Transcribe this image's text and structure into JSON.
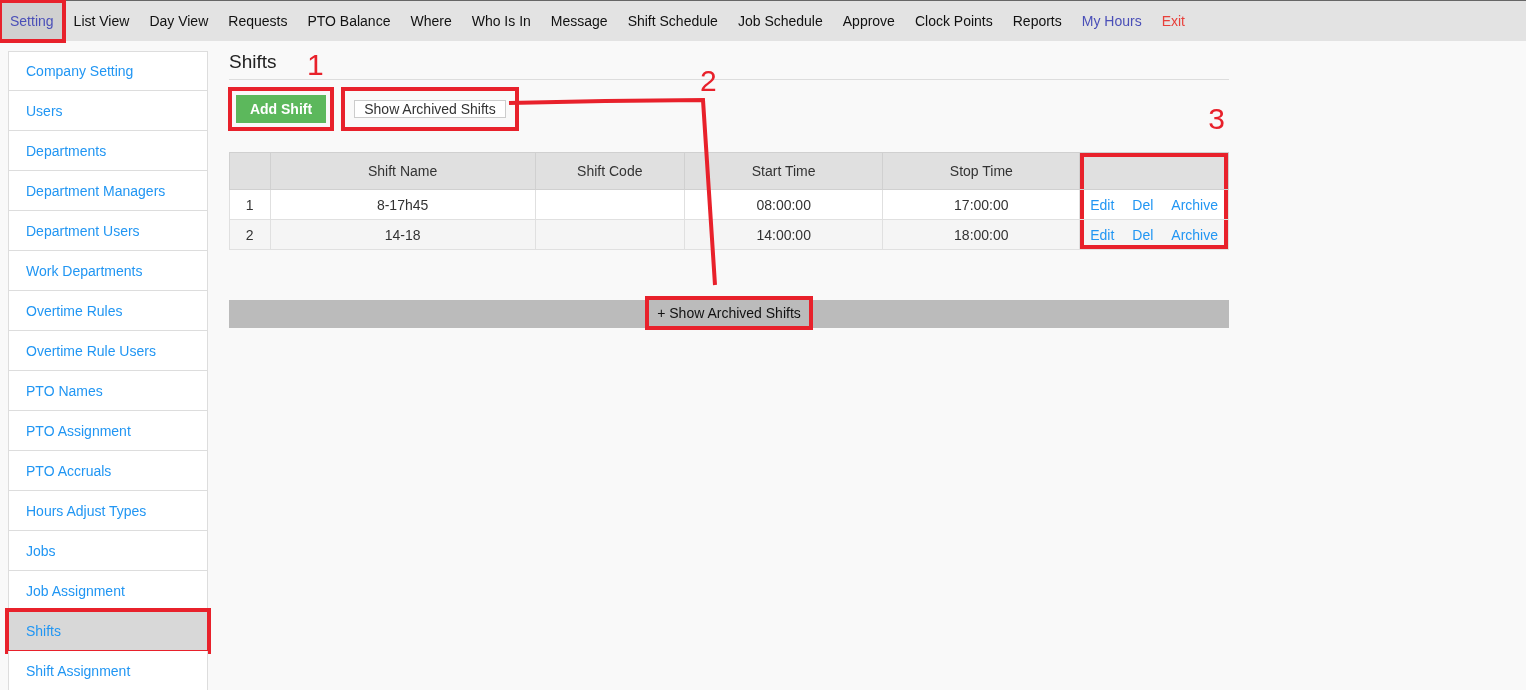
{
  "menu": [
    {
      "label": "Setting",
      "kind": "normal",
      "selected": true,
      "highlighted": true
    },
    {
      "label": "List View",
      "kind": "normal",
      "selected": false,
      "highlighted": false
    },
    {
      "label": "Day View",
      "kind": "normal",
      "selected": false,
      "highlighted": false
    },
    {
      "label": "Requests",
      "kind": "normal",
      "selected": false,
      "highlighted": false
    },
    {
      "label": "PTO Balance",
      "kind": "normal",
      "selected": false,
      "highlighted": false
    },
    {
      "label": "Where",
      "kind": "normal",
      "selected": false,
      "highlighted": false
    },
    {
      "label": "Who Is In",
      "kind": "normal",
      "selected": false,
      "highlighted": false
    },
    {
      "label": "Message",
      "kind": "normal",
      "selected": false,
      "highlighted": false
    },
    {
      "label": "Shift Schedule",
      "kind": "normal",
      "selected": false,
      "highlighted": false
    },
    {
      "label": "Job Schedule",
      "kind": "normal",
      "selected": false,
      "highlighted": false
    },
    {
      "label": "Approve",
      "kind": "normal",
      "selected": false,
      "highlighted": false
    },
    {
      "label": "Clock Points",
      "kind": "normal",
      "selected": false,
      "highlighted": false
    },
    {
      "label": "Reports",
      "kind": "normal",
      "selected": false,
      "highlighted": false
    },
    {
      "label": "My Hours",
      "kind": "user",
      "selected": false,
      "highlighted": false
    },
    {
      "label": "Exit",
      "kind": "exit",
      "selected": false,
      "highlighted": false
    }
  ],
  "sidebar": {
    "items": [
      {
        "label": "Company Setting",
        "selected": false,
        "highlighted": false
      },
      {
        "label": "Users",
        "selected": false,
        "highlighted": false
      },
      {
        "label": "Departments",
        "selected": false,
        "highlighted": false
      },
      {
        "label": "Department Managers",
        "selected": false,
        "highlighted": false
      },
      {
        "label": "Department Users",
        "selected": false,
        "highlighted": false
      },
      {
        "label": "Work Departments",
        "selected": false,
        "highlighted": false
      },
      {
        "label": "Overtime Rules",
        "selected": false,
        "highlighted": false
      },
      {
        "label": "Overtime Rule Users",
        "selected": false,
        "highlighted": false
      },
      {
        "label": "PTO Names",
        "selected": false,
        "highlighted": false
      },
      {
        "label": "PTO Assignment",
        "selected": false,
        "highlighted": false
      },
      {
        "label": "PTO Accruals",
        "selected": false,
        "highlighted": false
      },
      {
        "label": "Hours Adjust Types",
        "selected": false,
        "highlighted": false
      },
      {
        "label": "Jobs",
        "selected": false,
        "highlighted": false
      },
      {
        "label": "Job Assignment",
        "selected": false,
        "highlighted": false
      },
      {
        "label": "Shifts",
        "selected": true,
        "highlighted": true
      },
      {
        "label": "Shift Assignment",
        "selected": false,
        "highlighted": false
      }
    ]
  },
  "page": {
    "title": "Shifts",
    "buttons": [
      {
        "label": "Add Shift",
        "kind": "primary",
        "highlighted": true,
        "callout": "1"
      },
      {
        "label": "Show Archived Shifts",
        "kind": "default",
        "highlighted": true,
        "callout": "2"
      }
    ],
    "table": {
      "columns": [
        "Shift Name",
        "Shift Code",
        "Start Time",
        "Stop Time"
      ],
      "actions_highlighted": true,
      "actions_callout": "3",
      "rows": [
        {
          "index": "1",
          "cells": [
            "8-17h45",
            "",
            "08:00:00",
            "17:00:00"
          ],
          "actions": [
            "Edit",
            "Del",
            "Archive"
          ]
        },
        {
          "index": "2",
          "cells": [
            "14-18",
            "",
            "14:00:00",
            "18:00:00"
          ],
          "actions": [
            "Edit",
            "Del",
            "Archive"
          ]
        }
      ]
    },
    "archived_bar": {
      "label": "+ Show Archived Shifts",
      "highlighted": true
    }
  }
}
